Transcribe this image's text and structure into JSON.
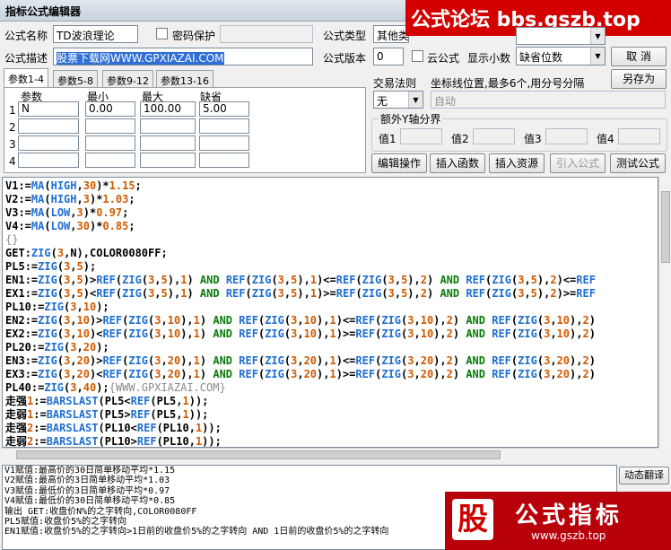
{
  "window": {
    "title": "指标公式编辑器"
  },
  "banner": {
    "text": "公式论坛 bbs.gszb.top"
  },
  "form": {
    "name_label": "公式名称",
    "name_value": "TD波浪理论",
    "password_label": "密码保护",
    "desc_label": "公式描述",
    "desc_value": "股票下载网WWW.GPXIAZAI.COM",
    "type_label": "公式类型",
    "type_value": "其他类",
    "version_label": "公式版本",
    "version_value": "0",
    "cloud_label": "云公式",
    "decimals_label": "显示小数",
    "decimals_value": "缺省位数",
    "trade_label": "交易法则",
    "trade_value": "无",
    "coord_label": "坐标线位置,最多6个,用分号分隔",
    "coord_value": "自动",
    "yaxis_label": "额外Y轴分界",
    "values": [
      "值1",
      "值2",
      "值3",
      "值4"
    ]
  },
  "buttons": {
    "cancel": "取 消",
    "save_as": "另存为",
    "edit_ops": "编辑操作",
    "insert_fn": "插入函数",
    "insert_res": "插入资源",
    "import": "引入公式",
    "test": "测试公式",
    "dynamic_translate": "动态翻译"
  },
  "tabs": [
    "参数1-4",
    "参数5-8",
    "参数9-12",
    "参数13-16"
  ],
  "params": {
    "headers": [
      "参数",
      "最小",
      "最大",
      "缺省"
    ],
    "rows": [
      {
        "idx": "1",
        "name": "N",
        "min": "0.00",
        "max": "100.00",
        "def": "5.00"
      },
      {
        "idx": "2",
        "name": "",
        "min": "",
        "max": "",
        "def": ""
      },
      {
        "idx": "3",
        "name": "",
        "min": "",
        "max": "",
        "def": ""
      },
      {
        "idx": "4",
        "name": "",
        "min": "",
        "max": "",
        "def": ""
      }
    ]
  },
  "code_lines": [
    "V1:=MA(HIGH,30)*1.15;",
    "V2:=MA(HIGH,3)*1.03;",
    "V3:=MA(LOW,3)*0.97;",
    "V4:=MA(LOW,30)*0.85;",
    "{}",
    "GET:ZIG(3,N),COLOR0080FF;",
    "PL5:=ZIG(3,5);",
    "EN1:=ZIG(3,5)>REF(ZIG(3,5),1) AND REF(ZIG(3,5),1)<=REF(ZIG(3,5),2) AND REF(ZIG(3,5),2)<=REF",
    "EX1:=ZIG(3,5)<REF(ZIG(3,5),1) AND REF(ZIG(3,5),1)>=REF(ZIG(3,5),2) AND REF(ZIG(3,5),2)>=REF",
    "PL10:=ZIG(3,10);",
    "EN2:=ZIG(3,10)>REF(ZIG(3,10),1) AND REF(ZIG(3,10),1)<=REF(ZIG(3,10),2) AND REF(ZIG(3,10),2)",
    "EX2:=ZIG(3,10)<REF(ZIG(3,10),1) AND REF(ZIG(3,10),1)>=REF(ZIG(3,10),2) AND REF(ZIG(3,10),2)",
    "PL20:=ZIG(3,20);",
    "EN3:=ZIG(3,20)>REF(ZIG(3,20),1) AND REF(ZIG(3,20),1)<=REF(ZIG(3,20),2) AND REF(ZIG(3,20),2)",
    "EX3:=ZIG(3,20)<REF(ZIG(3,20),1) AND REF(ZIG(3,20),1)>=REF(ZIG(3,20),2) AND REF(ZIG(3,20),2)",
    "PL40:=ZIG(3,40);{WWW.GPXIAZAI.COM}",
    "走强1:=BARSLAST(PL5<REF(PL5,1));",
    "走弱1:=BARSLAST(PL5>REF(PL5,1));",
    "走强2:=BARSLAST(PL10<REF(PL10,1));",
    "走弱2:=BARSLAST(PL10>REF(PL10,1));"
  ],
  "explain_lines": [
    "V1赋值:最高价的30日简单移动平均*1.15",
    "V2赋值:最高价的3日简单移动平均*1.03",
    "V3赋值:最低价的3日简单移动平均*0.97",
    "V4赋值:最低价的30日简单移动平均*0.85",
    "输出 GET:收盘价N%的之字转向,COLOR0080FF",
    "PL5赋值:收盘价5%的之字转向",
    "EN1赋值:收盘价5%的之字转向>1日前的收盘价5%的之字转向 AND 1日前的收盘价5%的之字转向"
  ],
  "ad": {
    "logo": "股",
    "title": "公式指标",
    "url": "www.gszb.top"
  }
}
